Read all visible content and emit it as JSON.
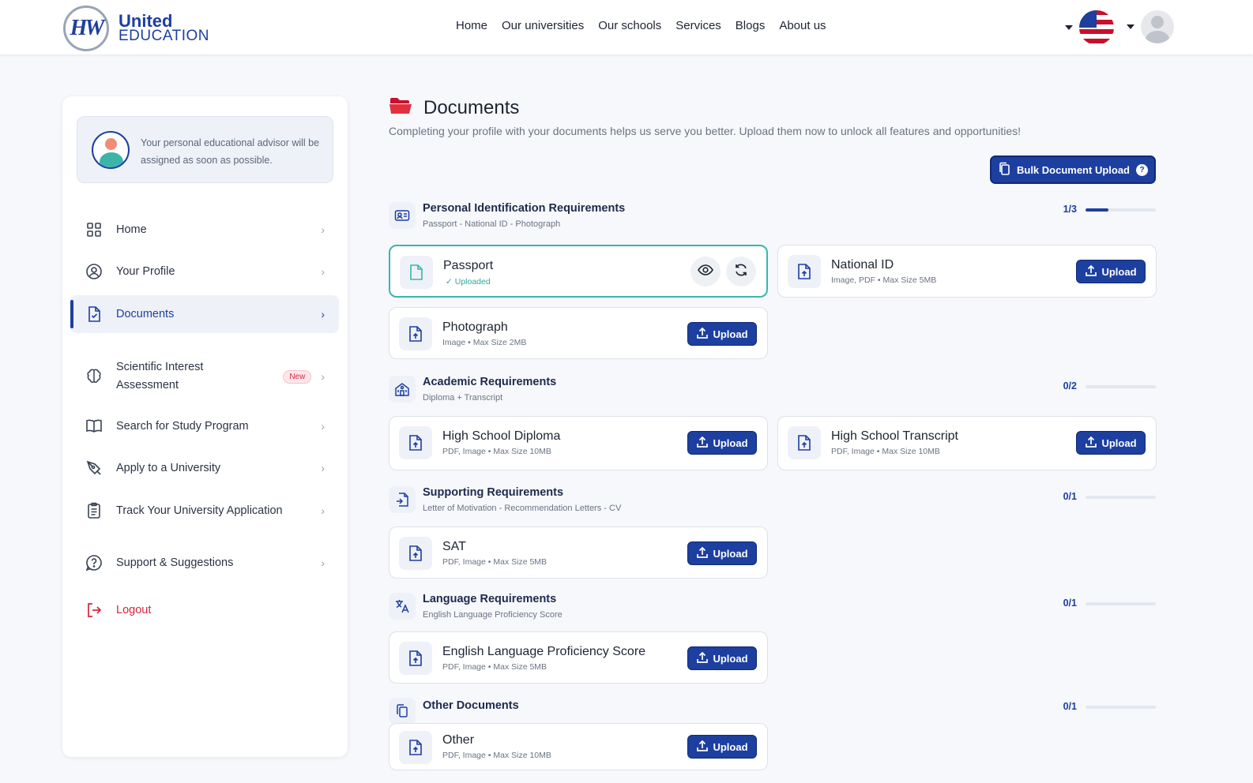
{
  "brand": {
    "line1": "United",
    "line2": "EDUCATION",
    "mark": "HW"
  },
  "nav": [
    "Home",
    "Our universities",
    "Our schools",
    "Services",
    "Blogs",
    "About us"
  ],
  "advisor_text": "Your personal educational advisor will be assigned as soon as possible.",
  "sidebar": {
    "items": [
      {
        "label": "Home",
        "icon": "grid-icon"
      },
      {
        "label": "Your Profile",
        "icon": "user-circle-icon"
      },
      {
        "label": "Documents",
        "icon": "document-check-icon"
      },
      {
        "label": "Scientific Interest Assessment",
        "icon": "brain-icon",
        "badge": "New"
      },
      {
        "label": "Search for Study Program",
        "icon": "book-icon"
      },
      {
        "label": "Apply to a University",
        "icon": "pen-icon"
      },
      {
        "label": "Track Your University Application",
        "icon": "clipboard-icon"
      },
      {
        "label": "Support & Suggestions",
        "icon": "help-chat-icon"
      }
    ],
    "logout": "Logout"
  },
  "page": {
    "title": "Documents",
    "description": "Completing your profile with your documents helps us serve you better. Upload them now to unlock all features and opportunities!",
    "bulk_button": "Bulk Document Upload",
    "upload_label": "Upload"
  },
  "sections": [
    {
      "title": "Personal Identification Requirements",
      "subtitle": "Passport - National ID - Photograph",
      "count": "1/3",
      "progress": 0.33,
      "docs": [
        {
          "name": "Passport",
          "status": "Uploaded"
        },
        {
          "name": "National ID",
          "meta": "Image, PDF • Max Size 5MB"
        },
        {
          "name": "Photograph",
          "meta": "Image • Max Size 2MB"
        }
      ]
    },
    {
      "title": "Academic Requirements",
      "subtitle": "Diploma + Transcript",
      "count": "0/2",
      "progress": 0,
      "docs": [
        {
          "name": "High School Diploma",
          "meta": "PDF, Image • Max Size 10MB"
        },
        {
          "name": "High School Transcript",
          "meta": "PDF, Image • Max Size 10MB"
        }
      ]
    },
    {
      "title": "Supporting Requirements",
      "subtitle": "Letter of Motivation - Recommendation Letters - CV",
      "count": "0/1",
      "progress": 0,
      "docs": [
        {
          "name": "SAT",
          "meta": "PDF, Image • Max Size 5MB"
        }
      ]
    },
    {
      "title": "Language Requirements",
      "subtitle": "English Language Proficiency Score",
      "count": "0/1",
      "progress": 0,
      "docs": [
        {
          "name": "English Language Proficiency Score",
          "meta": "PDF, Image • Max Size 5MB"
        }
      ]
    },
    {
      "title": "Other Documents",
      "count": "0/1",
      "progress": 0,
      "docs": [
        {
          "name": "Other",
          "meta": "PDF, Image • Max Size 10MB"
        }
      ]
    }
  ],
  "colors": {
    "primary": "#1d3f9f",
    "accent_teal": "#38b7ad",
    "danger": "#d7263d"
  }
}
